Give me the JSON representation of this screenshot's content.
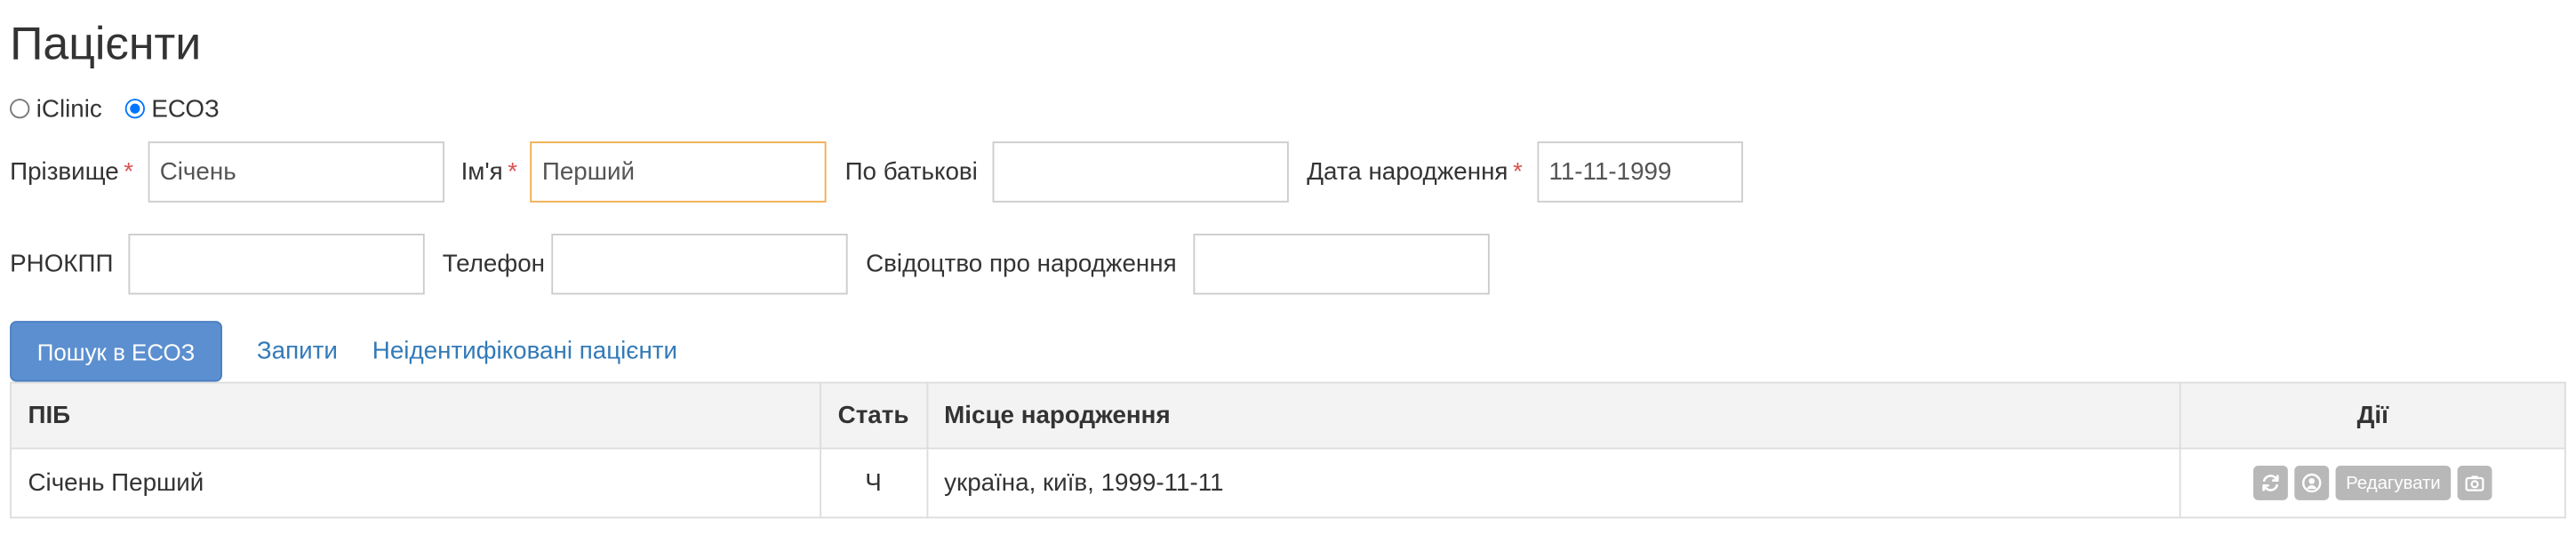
{
  "page": {
    "title": "Пацієнти"
  },
  "source_radio": {
    "options": [
      {
        "label": "iClinic",
        "checked": false
      },
      {
        "label": "ЕСОЗ",
        "checked": true
      }
    ]
  },
  "form": {
    "last_name": {
      "label": "Прізвище",
      "required_mark": "*",
      "value": "Січень"
    },
    "first_name": {
      "label": "Ім'я",
      "required_mark": "*",
      "value": "Перший"
    },
    "patronymic": {
      "label": "По батькові",
      "value": ""
    },
    "birth_date": {
      "label": "Дата народження",
      "required_mark": "*",
      "value": "11-11-1999"
    },
    "tax_id": {
      "label": "РНОКПП",
      "value": ""
    },
    "phone": {
      "label": "Телефон",
      "value": ""
    },
    "birth_certificate": {
      "label": "Свідоцтво про народження",
      "value": ""
    }
  },
  "actions": {
    "search_button": "Пошук в ЕСОЗ",
    "requests_link": "Запити",
    "unidentified_link": "Неідентифіковані пацієнти"
  },
  "table": {
    "columns": [
      "ПІБ",
      "Стать",
      "Місце народження",
      "Дії"
    ],
    "rows": [
      {
        "name": "Січень Перший",
        "sex": "Ч",
        "birth_place": "україна, київ, 1999-11-11"
      }
    ],
    "row_actions": {
      "sync_icon": "refresh-icon",
      "profile_icon": "user-circle-icon",
      "edit_label": "Редагувати",
      "camera_icon": "camera-icon"
    }
  },
  "colors": {
    "primary": "#5b8fcf",
    "link": "#337ab7",
    "required": "#d9534f",
    "focus_border": "#f0ad4e",
    "action_button": "#b8b8b8"
  }
}
